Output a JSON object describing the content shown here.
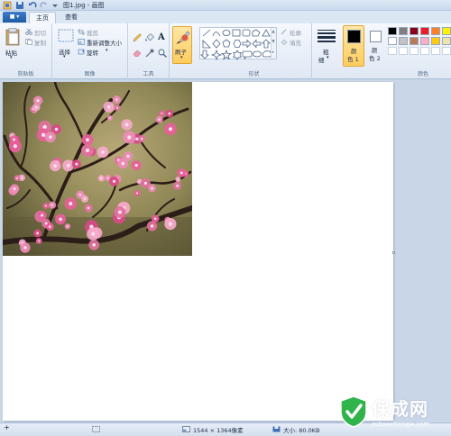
{
  "window": {
    "title": "图1.jpg - 画图"
  },
  "tabs": {
    "file": "■ ▾",
    "home": "主页",
    "view": "查看"
  },
  "ribbon": {
    "clipboard": {
      "paste": "粘贴",
      "cut": "剪切",
      "copy": "复制",
      "group": "剪贴板"
    },
    "image": {
      "select": "选择",
      "crop": "裁剪",
      "resize": "重新调整大小",
      "rotate": "旋转",
      "group": "图像"
    },
    "tools": {
      "group": "工具"
    },
    "brushes": {
      "label": "刷子"
    },
    "shapes": {
      "outline": "轮廓",
      "fill": "填充",
      "group": "形状"
    },
    "size": {
      "label_line1": "粗",
      "label_line2": "细"
    },
    "colors": {
      "color1_line1": "颜",
      "color1_line2": "色 1",
      "color2_line1": "颜",
      "color2_line2": "色 2",
      "group": "颜色",
      "color1": "#000000",
      "color2": "#ffffff"
    }
  },
  "palette": [
    "#000000",
    "#7f7f7f",
    "#880015",
    "#ed1c24",
    "#ff7f27",
    "#fff200",
    "#ffffff",
    "#c3c3c3",
    "#b97a57",
    "#ffaec9",
    "#ffc90e",
    "#efe4b0"
  ],
  "status": {
    "dimensions": "1544 × 1364像素",
    "size": "大小: 80.0KB"
  },
  "watermark": {
    "brand": "保成网",
    "url": "zsbaochengw.com"
  }
}
